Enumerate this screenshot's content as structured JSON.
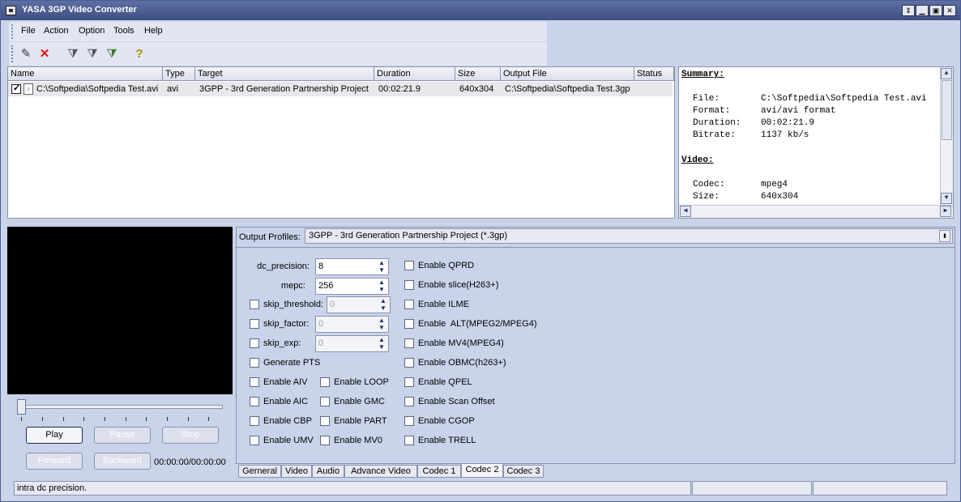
{
  "window": {
    "title": "YASA 3GP Video Converter"
  },
  "menu": [
    "File",
    "Action",
    "Option",
    "Tools",
    "Help"
  ],
  "toolbar_icons": [
    "wand-icon",
    "delete-icon",
    "filter-icon",
    "filter-edit-icon",
    "filter-add-icon",
    "help-icon"
  ],
  "file_list": {
    "columns": [
      "Name",
      "Type",
      "Target",
      "Duration",
      "Size",
      "Output File",
      "Status"
    ],
    "rows": [
      {
        "checked": true,
        "name": "C:\\Softpedia\\Softpedia Test.avi",
        "type": "avi",
        "target": "3GPP - 3rd Generation Partnership Project",
        "duration": "00:02:21.9",
        "size": "640x304",
        "output": "C:\\Softpedia\\Softpedia Test.3gp",
        "status": ""
      }
    ]
  },
  "summary": {
    "heading": "Summary:",
    "file_label": "File:",
    "file_value": "C:\\Softpedia\\Softpedia Test.avi",
    "format_label": "Format:",
    "format_value": "avi/avi format",
    "duration_label": "Duration:",
    "duration_value": "00:02:21.9",
    "bitrate_label": "Bitrate:",
    "bitrate_value": "1137 kb/s",
    "video_heading": "Video:",
    "codec_label": "Codec:",
    "codec_value": "mpeg4",
    "size_label": "Size:",
    "size_value": "640x304"
  },
  "player": {
    "play": "Play",
    "pause": "Pause",
    "stop": "Stop",
    "forward": "Forward",
    "backward": "Backward",
    "time": "00:00:00/00:00:00",
    "position": 0
  },
  "settings": {
    "profiles_label": "Output Profiles:",
    "profile_value": "3GPP - 3rd Generation Partnership Project (*.3gp)",
    "dc_precision_label": "dc_precision:",
    "dc_precision_value": "8",
    "mepc_label": "mepc:",
    "mepc_value": "256",
    "skip_threshold_label": "skip_threshold:",
    "skip_threshold_value": "0",
    "skip_factor_label": "skip_factor:",
    "skip_factor_value": "0",
    "skip_exp_label": "skip_exp:",
    "skip_exp_value": "0",
    "generate_pts": "Generate PTS",
    "enable_aiv": "Enable AIV",
    "enable_aic": "Enable AIC",
    "enable_cbp": "Enable CBP",
    "enable_umv": "Enable UMV",
    "enable_loop": "Enable LOOP",
    "enable_gmc": "Enable GMC",
    "enable_part": "Enable PART",
    "enable_mv0": "Enable MV0",
    "enable_qprd": "Enable QPRD",
    "enable_slice": "Enable slice(H263+)",
    "enable_ilme": "Enable ILME",
    "enable_alt": "Enable  ALT(MPEG2/MPEG4)",
    "enable_mv4": "Enable MV4(MPEG4)",
    "enable_obmc": "Enable OBMC(h263+)",
    "enable_qpel": "Enable QPEL",
    "enable_scan_offset": "Enable Scan Offset",
    "enable_cgop": "Enable CGOP",
    "enable_trell": "Enable TRELL"
  },
  "tabs": [
    "Gerneral",
    "Video",
    "Audio",
    "Advance Video",
    "Codec 1",
    "Codec 2",
    "Codec 3"
  ],
  "selected_tab": "Codec 2",
  "status": {
    "text": "intra dc precision."
  }
}
